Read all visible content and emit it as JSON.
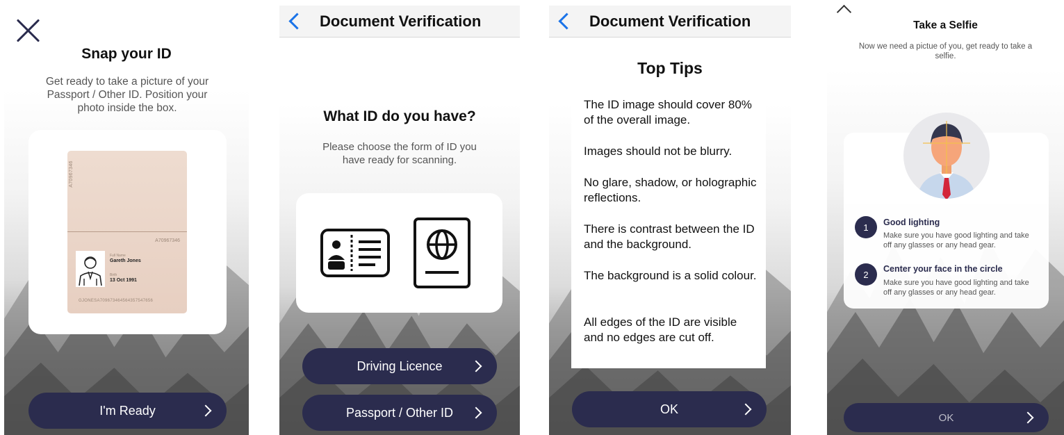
{
  "screen1": {
    "title": "Snap your ID",
    "subtitle": "Get ready to take a picture of your Passport / Other ID. Position your photo inside the box.",
    "passport": {
      "number_vertical": "A70967346",
      "number": "A70967346",
      "full_name_label": "Full Name",
      "full_name": "Gareth Jones",
      "birth_label": "Birth",
      "birth_date": "13 Oct 1991",
      "mrz": "GJONESA709673464564357547656"
    },
    "button_label": "I'm Ready"
  },
  "screen2": {
    "nav_title": "Document Verification",
    "question": "What ID do you have?",
    "subtitle": "Please choose the form of ID you have ready for scanning.",
    "buttons": [
      "Driving Licence",
      "Passport / Other ID"
    ]
  },
  "screen3": {
    "nav_title": "Document Verification",
    "title": "Top Tips",
    "tips": [
      "The ID image should cover 80% of the overall image.",
      "Images should not be blurry.",
      "No glare, shadow, or holographic reflections.",
      "There is contrast between the ID and the background.",
      "The background is a solid colour.",
      "All edges of the ID are visible and no edges are cut off."
    ],
    "button_label": "OK"
  },
  "screen4": {
    "title": "Take a Selfie",
    "subtitle": "Now we need a pictue of you, get ready to take a selfie.",
    "steps": [
      {
        "num": "1",
        "title": "Good lighting",
        "body": "Make sure you have good lighting and take off any glasses or any head gear."
      },
      {
        "num": "2",
        "title": "Center your face in the circle",
        "body": "Make sure you have good lighting and take off any glasses or any head gear."
      }
    ],
    "button_label": "OK"
  },
  "colors": {
    "primary": "#2b2c4e",
    "ios_blue": "#1a73e8"
  }
}
